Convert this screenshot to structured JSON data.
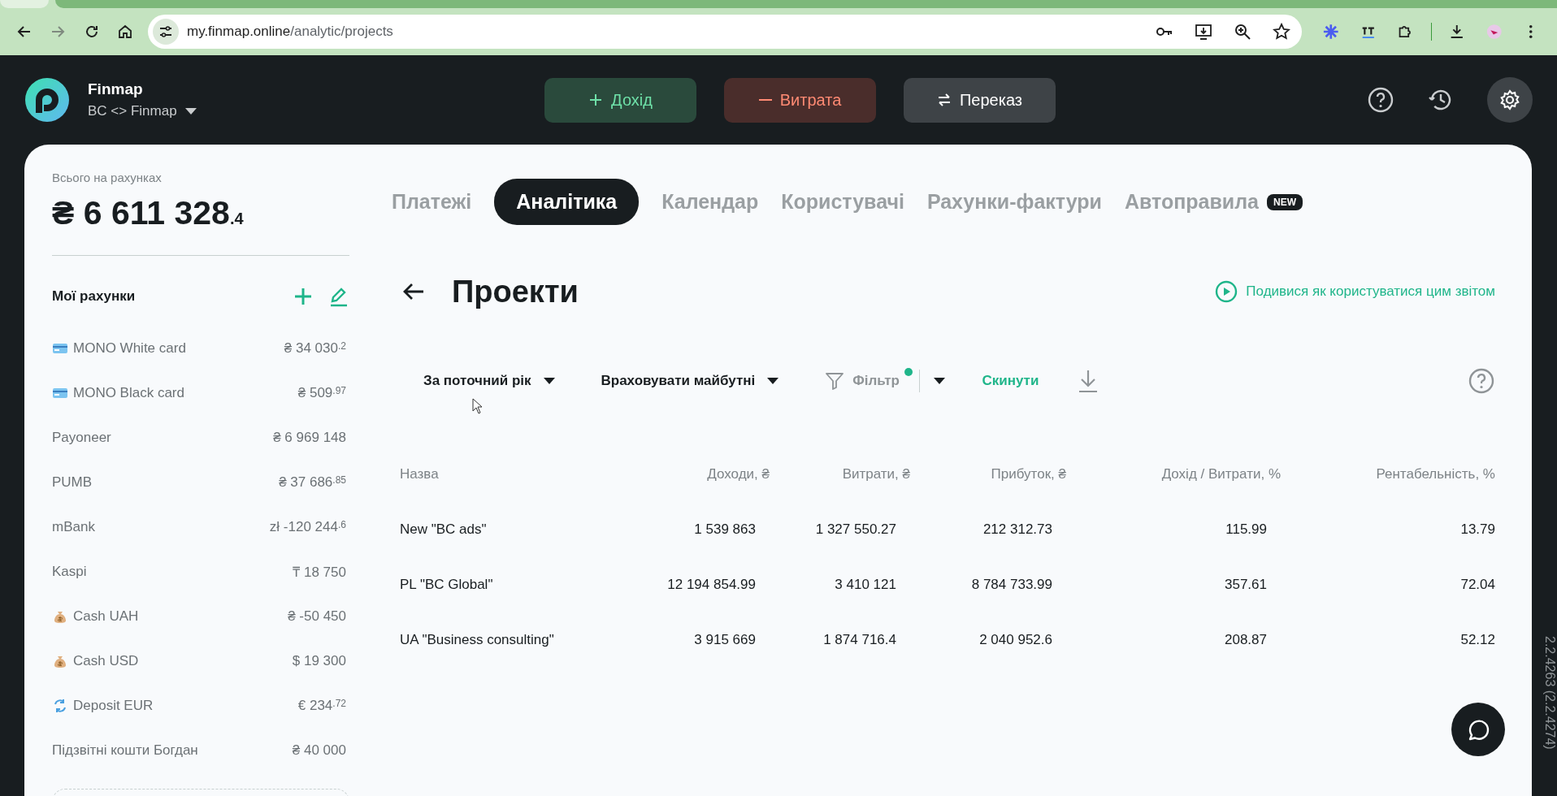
{
  "browser": {
    "url_host": "my.finmap.online",
    "url_path": "/analytic/projects"
  },
  "app": {
    "brand": "Finmap",
    "workspace": "BC <> Finmap"
  },
  "actions": [
    {
      "kind": "income",
      "label": "Дохід"
    },
    {
      "kind": "expense",
      "label": "Витрата"
    },
    {
      "kind": "transfer",
      "label": "Переказ"
    }
  ],
  "sidebar": {
    "total_label": "Всього на рахунках",
    "total": {
      "amount": "₴ 6 611 328",
      "decimals": ".4"
    },
    "accounts_title": "Мої рахунки",
    "accounts": [
      {
        "kind": "card",
        "name": "MONO White card",
        "amount": "₴ 34 030",
        "decimals": ".2"
      },
      {
        "kind": "card",
        "name": "MONO Black card",
        "amount": "₴ 509",
        "decimals": ".97"
      },
      {
        "kind": "plain",
        "name": "Payoneer",
        "amount": "₴ 6 969 148"
      },
      {
        "kind": "plain",
        "name": "PUMB",
        "amount": "₴ 37 686",
        "decimals": ".85"
      },
      {
        "kind": "plain",
        "name": "mBank",
        "amount": "zł -120 244",
        "decimals": ".6"
      },
      {
        "kind": "plain",
        "name": "Kaspi",
        "amount": "₸ 18 750"
      },
      {
        "kind": "cash",
        "name": "Cash UAH",
        "amount": "₴ -50 450"
      },
      {
        "kind": "cash",
        "name": "Cash USD",
        "amount": "$  19 300"
      },
      {
        "kind": "deposit",
        "name": "Deposit EUR",
        "amount": "€ 234",
        "decimals": ".72"
      },
      {
        "kind": "plain",
        "name": "Підзвітні кошти Богдан",
        "amount": "₴ 40 000"
      }
    ]
  },
  "tabs": [
    {
      "label": "Платежі",
      "selected": false
    },
    {
      "label": "Аналітика",
      "selected": true
    },
    {
      "label": "Календар",
      "selected": false
    },
    {
      "label": "Користувачі",
      "selected": false
    },
    {
      "label": "Рахунки-фактури",
      "selected": false
    },
    {
      "label": "Автоправила",
      "selected": false,
      "badge": "NEW"
    }
  ],
  "page": {
    "title": "Проекти",
    "help_link": "Подивися як користуватися цим звітом"
  },
  "filters": {
    "period": "За поточний рік",
    "future": "Враховувати майбутні",
    "filter": "Фільтр",
    "filter_active": true,
    "reset": "Скинути"
  },
  "table": {
    "columns": [
      "Назва",
      "Доходи, ₴",
      "Витрати, ₴",
      "Прибуток, ₴",
      "Дохід / Витрати, %",
      "Рентабельність, %"
    ],
    "rows": [
      [
        "New \"BC ads\"",
        "1 539 863",
        "1 327 550.27",
        "212 312.73",
        "115.99",
        "13.79"
      ],
      [
        "PL \"BC Global\"",
        "12 194 854.99",
        "3 410 121",
        "8 784 733.99",
        "357.61",
        "72.04"
      ],
      [
        "UA \"Business consulting\"",
        "3 915 669",
        "1 874 716.4",
        "2 040 952.6",
        "208.87",
        "52.12"
      ]
    ]
  },
  "version": "2.2.4263 (2.2.4274)"
}
